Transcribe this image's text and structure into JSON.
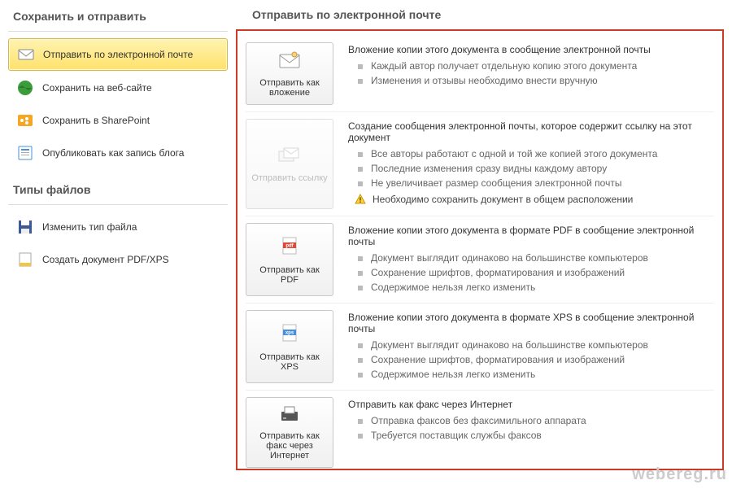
{
  "sidebar": {
    "section1_title": "Сохранить и отправить",
    "items1": [
      {
        "label": "Отправить по электронной почте"
      },
      {
        "label": "Сохранить на веб-сайте"
      },
      {
        "label": "Сохранить в SharePoint"
      },
      {
        "label": "Опубликовать как запись блога"
      }
    ],
    "section2_title": "Типы файлов",
    "items2": [
      {
        "label": "Изменить тип файла"
      },
      {
        "label": "Создать документ PDF/XPS"
      }
    ]
  },
  "main": {
    "title": "Отправить по электронной почте",
    "options": [
      {
        "button": "Отправить как вложение",
        "heading": "Вложение копии этого документа в сообщение электронной почты",
        "bullets": [
          "Каждый автор получает отдельную копию этого документа",
          "Изменения и отзывы необходимо внести вручную"
        ],
        "disabled": false
      },
      {
        "button": "Отправить ссылку",
        "heading": "Создание сообщения электронной почты, которое содержит ссылку на этот документ",
        "bullets": [
          "Все авторы работают с одной и той же копией этого документа",
          "Последние изменения сразу видны каждому автору",
          "Не увеличивает размер сообщения электронной почты"
        ],
        "warning": "Необходимо сохранить документ в общем расположении",
        "disabled": true
      },
      {
        "button": "Отправить как PDF",
        "heading": "Вложение копии этого документа в формате PDF в сообщение электронной почты",
        "bullets": [
          "Документ выглядит одинаково на большинстве компьютеров",
          "Сохранение шрифтов, форматирования и изображений",
          "Содержимое нельзя легко изменить"
        ],
        "disabled": false
      },
      {
        "button": "Отправить как XPS",
        "heading": "Вложение копии этого документа в формате XPS в сообщение электронной почты",
        "bullets": [
          "Документ выглядит одинаково на большинстве компьютеров",
          "Сохранение шрифтов, форматирования и изображений",
          "Содержимое нельзя легко изменить"
        ],
        "disabled": false
      },
      {
        "button": "Отправить как факс через Интернет",
        "heading": "Отправить как факс через Интернет",
        "bullets": [
          "Отправка факсов без факсимильного аппарата",
          "Требуется поставщик службы факсов"
        ],
        "disabled": false
      }
    ]
  },
  "watermark": "webereg.ru"
}
